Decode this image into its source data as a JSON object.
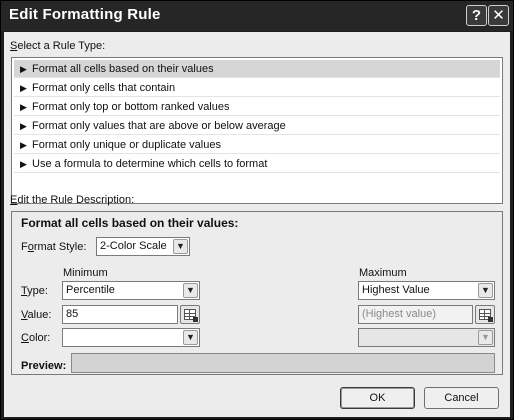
{
  "window": {
    "title": "Edit Formatting Rule",
    "help_glyph": "?",
    "close_glyph": "✕"
  },
  "rule_type": {
    "label_accel": "S",
    "label_rest": "elect a Rule Type:",
    "items": [
      "Format all cells based on their values",
      "Format only cells that contain",
      "Format only top or bottom ranked values",
      "Format only values that are above or below average",
      "Format only unique or duplicate values",
      "Use a formula to determine which cells to format"
    ],
    "selected_index": 0
  },
  "description": {
    "label_accel": "E",
    "label_rest": "dit the Rule Description:",
    "heading": "Format all cells based on their values:",
    "format_style_label_pre": "F",
    "format_style_label_accel": "o",
    "format_style_label_post": "rmat Style:",
    "format_style_value": "2-Color Scale",
    "minimum_header": "Minimum",
    "maximum_header": "Maximum",
    "type_label_accel": "T",
    "type_label_rest": "ype:",
    "value_label_accel": "V",
    "value_label_rest": "alue:",
    "color_label_accel": "C",
    "color_label_rest": "olor:",
    "min_type": "Percentile",
    "min_value": "85",
    "min_color": "",
    "max_type": "Highest Value",
    "max_value": "(Highest value)",
    "max_color": "",
    "preview_label": "Preview:",
    "preview_color": "#d3d3d3"
  },
  "buttons": {
    "ok": "OK",
    "cancel": "Cancel"
  },
  "icons": {
    "rule_arrow": "▶",
    "dropdown": "▼",
    "cell_reference": "collapse-dialog-icon"
  }
}
